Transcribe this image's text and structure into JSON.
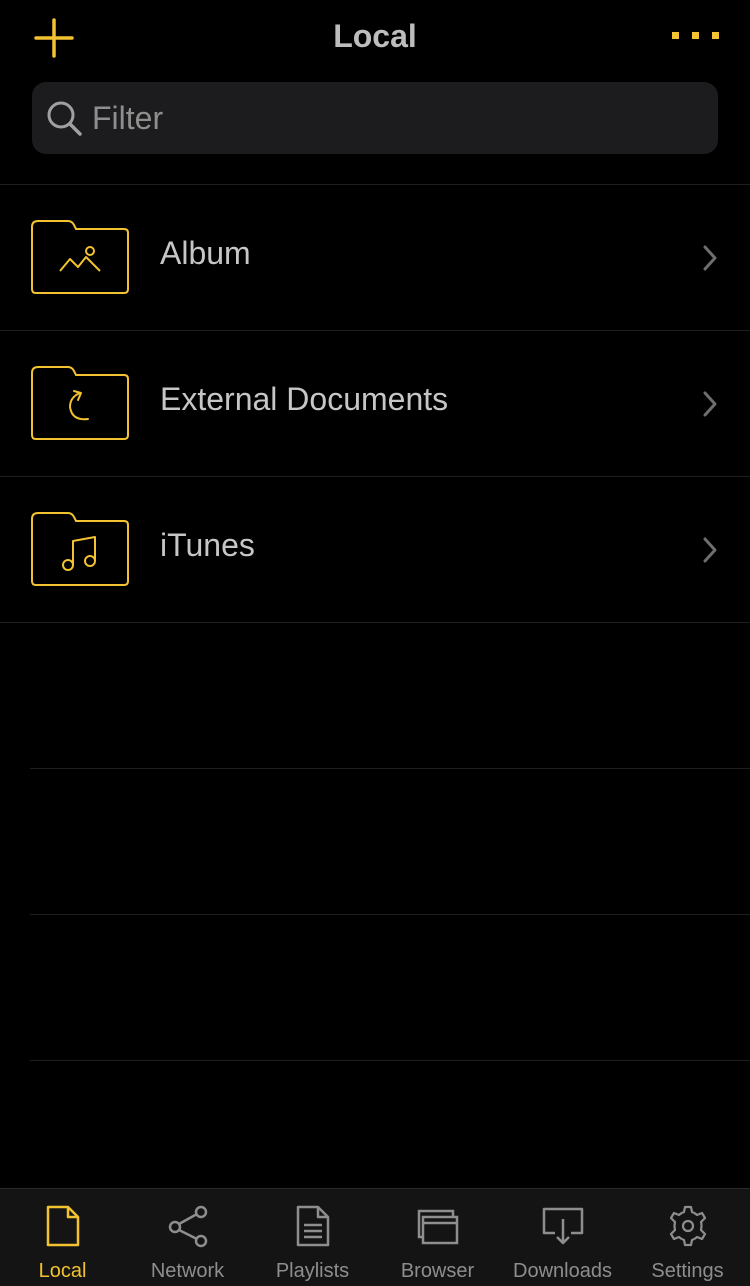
{
  "colors": {
    "accent": "#f2c230",
    "background": "#000000",
    "tab_inactive": "#8e8e8e"
  },
  "nav": {
    "title": "Local",
    "add_icon": "plus-icon",
    "more_icon": "ellipsis-icon"
  },
  "search": {
    "placeholder": "Filter",
    "value": ""
  },
  "folders": [
    {
      "label": "Album",
      "icon": "folder-photo-icon"
    },
    {
      "label": "External Documents",
      "icon": "folder-import-icon"
    },
    {
      "label": "iTunes",
      "icon": "folder-music-icon"
    }
  ],
  "tabs": [
    {
      "label": "Local",
      "icon": "document-icon",
      "active": true
    },
    {
      "label": "Network",
      "icon": "share-icon",
      "active": false
    },
    {
      "label": "Playlists",
      "icon": "playlist-icon",
      "active": false
    },
    {
      "label": "Browser",
      "icon": "browser-windows-icon",
      "active": false
    },
    {
      "label": "Downloads",
      "icon": "download-tray-icon",
      "active": false
    },
    {
      "label": "Settings",
      "icon": "gear-icon",
      "active": false
    }
  ]
}
